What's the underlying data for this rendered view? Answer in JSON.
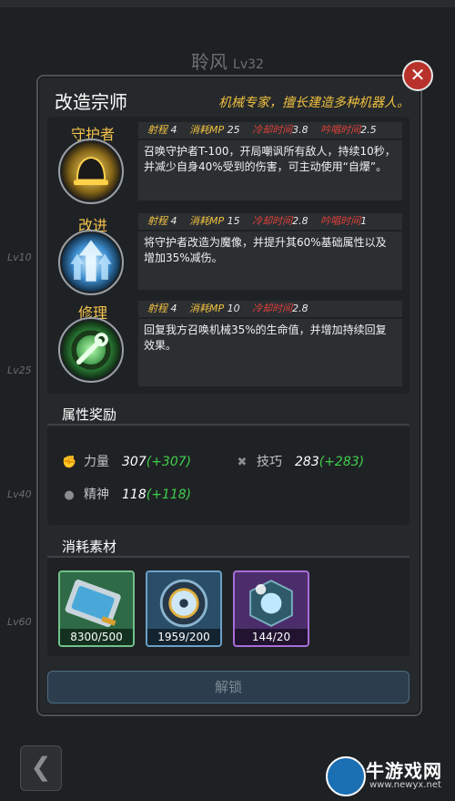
{
  "background": {
    "hero_name": "聆风",
    "hero_level": "Lv32",
    "level_markers": [
      "Lv10",
      "Lv25",
      "Lv40",
      "Lv60"
    ],
    "back_icon": "chevron-left-icon"
  },
  "watermark": {
    "text": "牛游戏网",
    "url": "www.newyx.net"
  },
  "dialog": {
    "title": "改造宗师",
    "subtitle": "机械专家，擅长建造多种机器人。",
    "close_icon": "close-icon",
    "skills": [
      {
        "name": "守护者",
        "icon": "dome-guardian-icon",
        "range_label": "射程",
        "range": "4",
        "mp_label": "消耗MP",
        "mp": "25",
        "cooldown_label": "冷却时间",
        "cooldown": "3.8",
        "cast_label": "吟唱时间",
        "cast": "2.5",
        "description": "召唤守护者T-100，开局嘲讽所有敌人，持续10秒，并减少自身40%受到的伤害，可主动使用“自爆”。"
      },
      {
        "name": "改进",
        "icon": "upgrade-arrows-icon",
        "range_label": "射程",
        "range": "4",
        "mp_label": "消耗MP",
        "mp": "15",
        "cooldown_label": "冷却时间",
        "cooldown": "2.8",
        "cast_label": "吟唱时间",
        "cast": "1",
        "description": "将守护者改造为魔像，并提升其60%基础属性以及增加35%减伤。"
      },
      {
        "name": "修理",
        "icon": "wrench-repair-icon",
        "range_label": "射程",
        "range": "4",
        "mp_label": "消耗MP",
        "mp": "10",
        "cooldown_label": "冷却时间",
        "cooldown": "2.8",
        "description": "回复我方召唤机械35%的生命值，并增加持续回复效果。"
      }
    ],
    "attributes_title": "属性奖励",
    "attributes": [
      {
        "icon": "fist-icon",
        "label": "力量",
        "value": "307",
        "bonus": "(+307)"
      },
      {
        "icon": "crossed-tools-icon",
        "label": "技巧",
        "value": "283",
        "bonus": "(+283)"
      },
      {
        "icon": "mind-icon",
        "label": "精神",
        "value": "118",
        "bonus": "(+118)"
      }
    ],
    "materials_title": "消耗素材",
    "materials": [
      {
        "icon": "blueprint-chip-icon",
        "count": "8300/500",
        "rarity_color": "#2e6a45"
      },
      {
        "icon": "gear-core-icon",
        "count": "1959/200",
        "rarity_color": "#2a4e68"
      },
      {
        "icon": "energy-core-icon",
        "count": "144/20",
        "rarity_color": "#4c2d6c"
      }
    ],
    "unlock_label": "解锁"
  },
  "colors": {
    "accent_gold": "#f0c040",
    "cooldown_red": "#e0413a",
    "bonus_green": "#3fcf4b"
  }
}
